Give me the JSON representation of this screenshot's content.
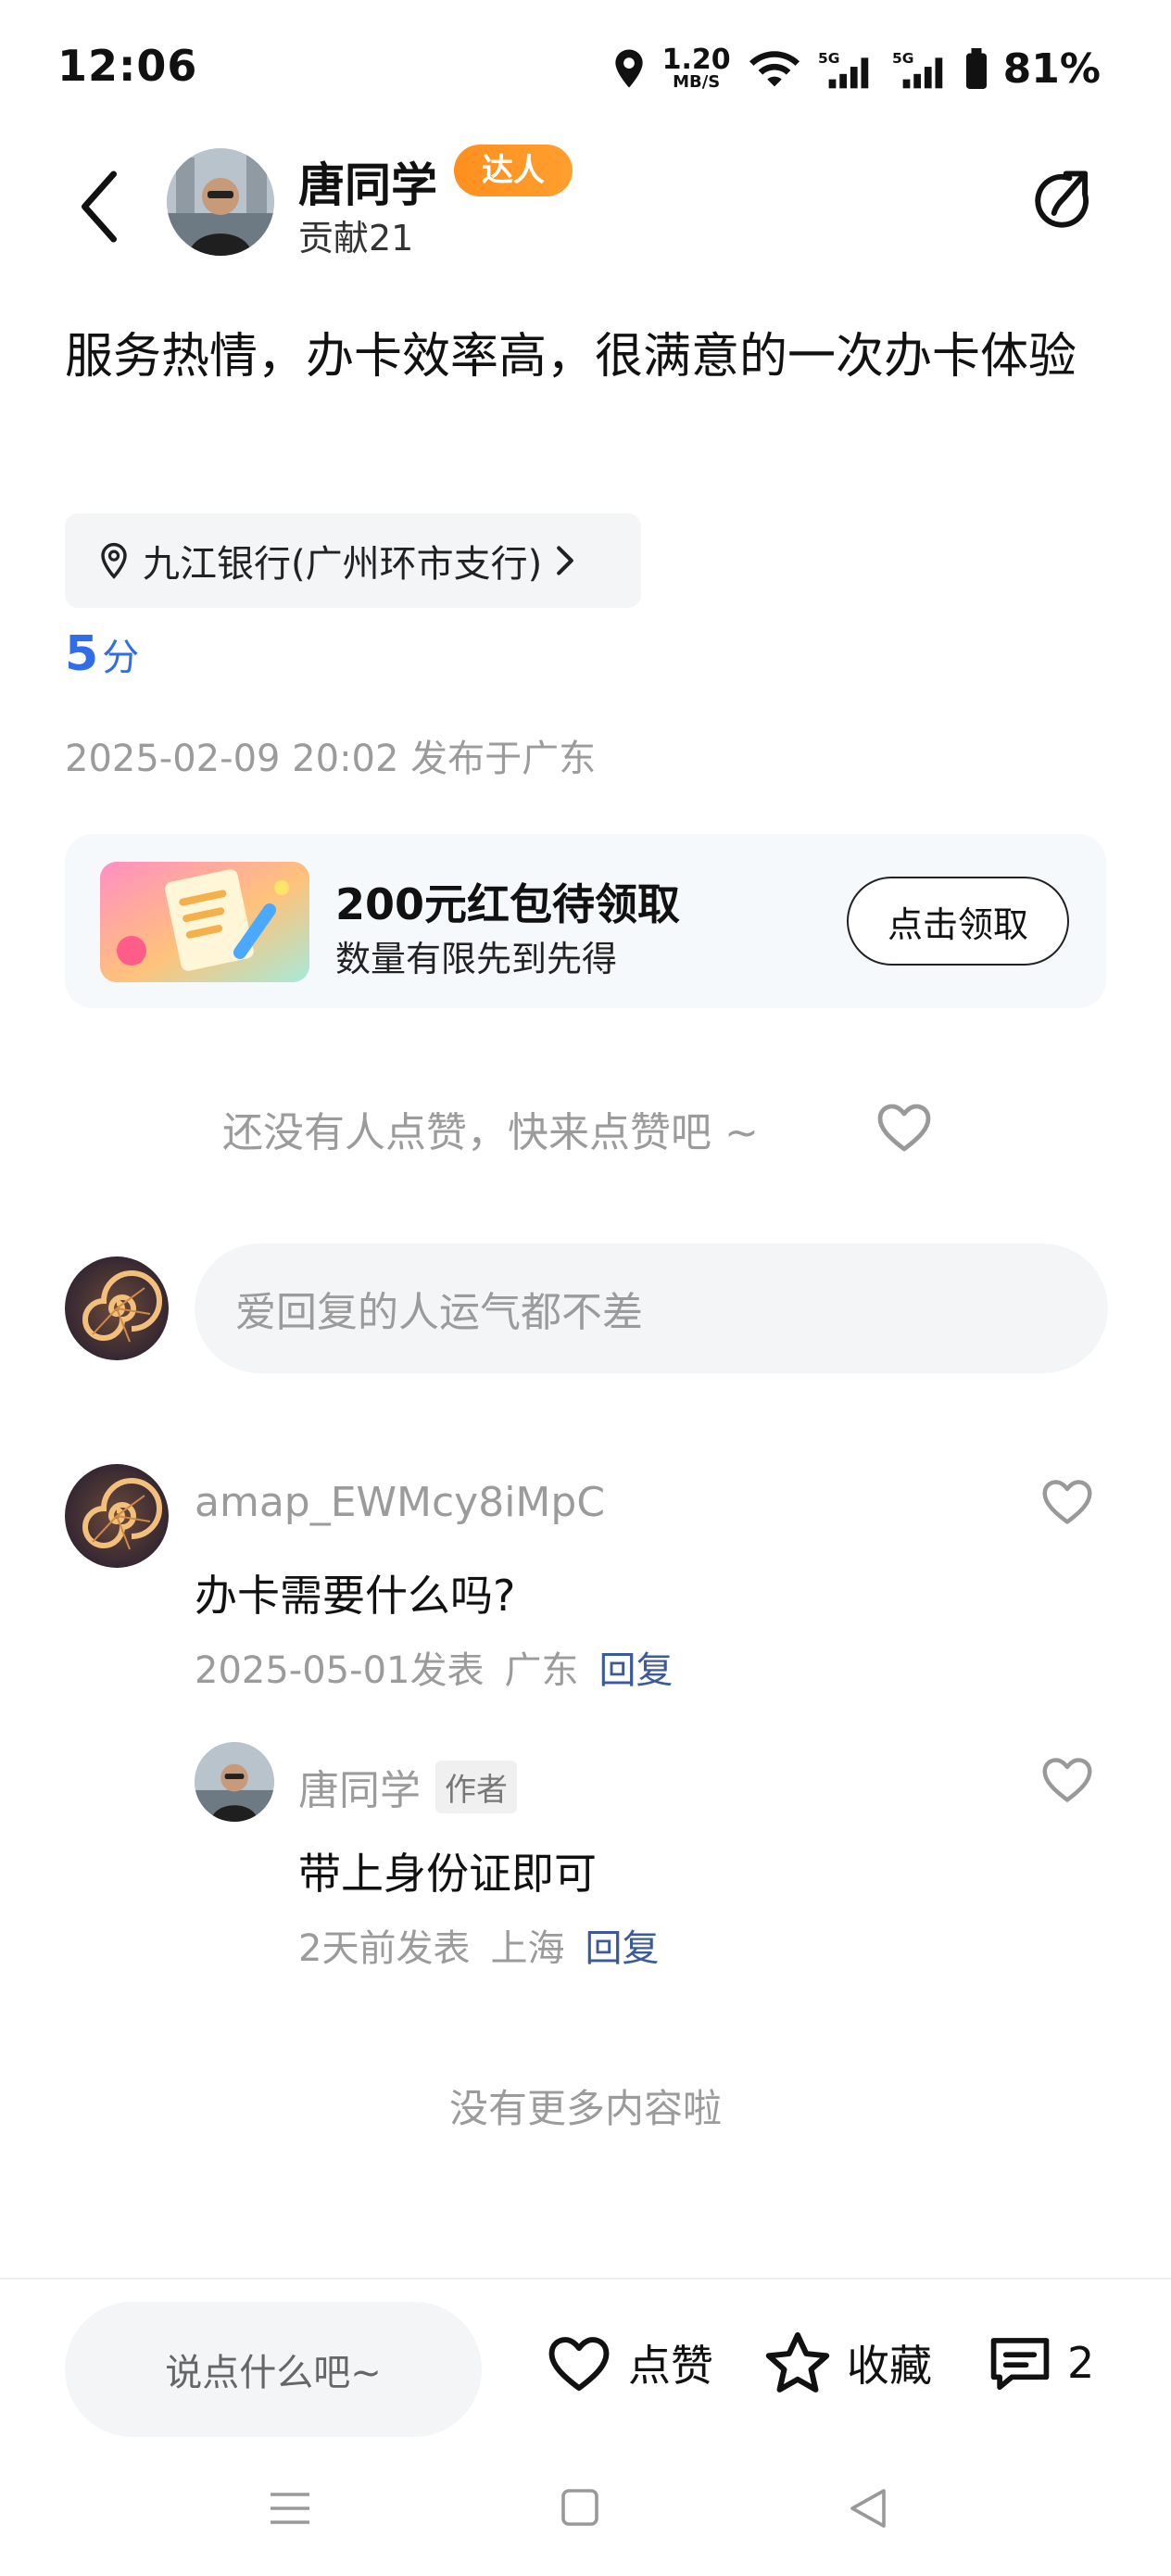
{
  "status_bar": {
    "time": "12:06",
    "net_speed_value": "1.20",
    "net_speed_unit": "MB/S",
    "signal_1": "5G",
    "signal_2": "5G",
    "battery": "81%"
  },
  "header": {
    "author_name": "唐同学",
    "badge": "达人",
    "contribution": "贡献21"
  },
  "post": {
    "text": "服务热情，办卡效率高，很满意的一次办卡体验",
    "location": "九江银行(广州环市支行)",
    "score_value": "5",
    "score_unit": "分",
    "meta": "2025-02-09 20:02 发布于广东"
  },
  "promo": {
    "title": "200元红包待领取",
    "subtitle": "数量有限先到先得",
    "button": "点击领取"
  },
  "likes": {
    "hint": "还没有人点赞，快来点赞吧 ~"
  },
  "reply_box": {
    "placeholder": "爱回复的人运气都不差"
  },
  "comments": [
    {
      "user": "amap_EWMcy8iMpC",
      "text": "办卡需要什么吗?",
      "date": "2025-05-01发表",
      "region": "广东",
      "reply": "回复"
    },
    {
      "user": "唐同学",
      "tag": "作者",
      "text": "带上身份证即可",
      "date": "2天前发表",
      "region": "上海",
      "reply": "回复"
    }
  ],
  "no_more": "没有更多内容啦",
  "bottom_bar": {
    "say_placeholder": "说点什么吧~",
    "like_label": "点赞",
    "fav_label": "收藏",
    "comment_count": "2"
  },
  "colors": {
    "accent_blue": "#2f6ee8",
    "badge_orange": "#ff8f1f",
    "reply_link": "#3c5a9a",
    "muted_text": "#9b9b9b"
  }
}
